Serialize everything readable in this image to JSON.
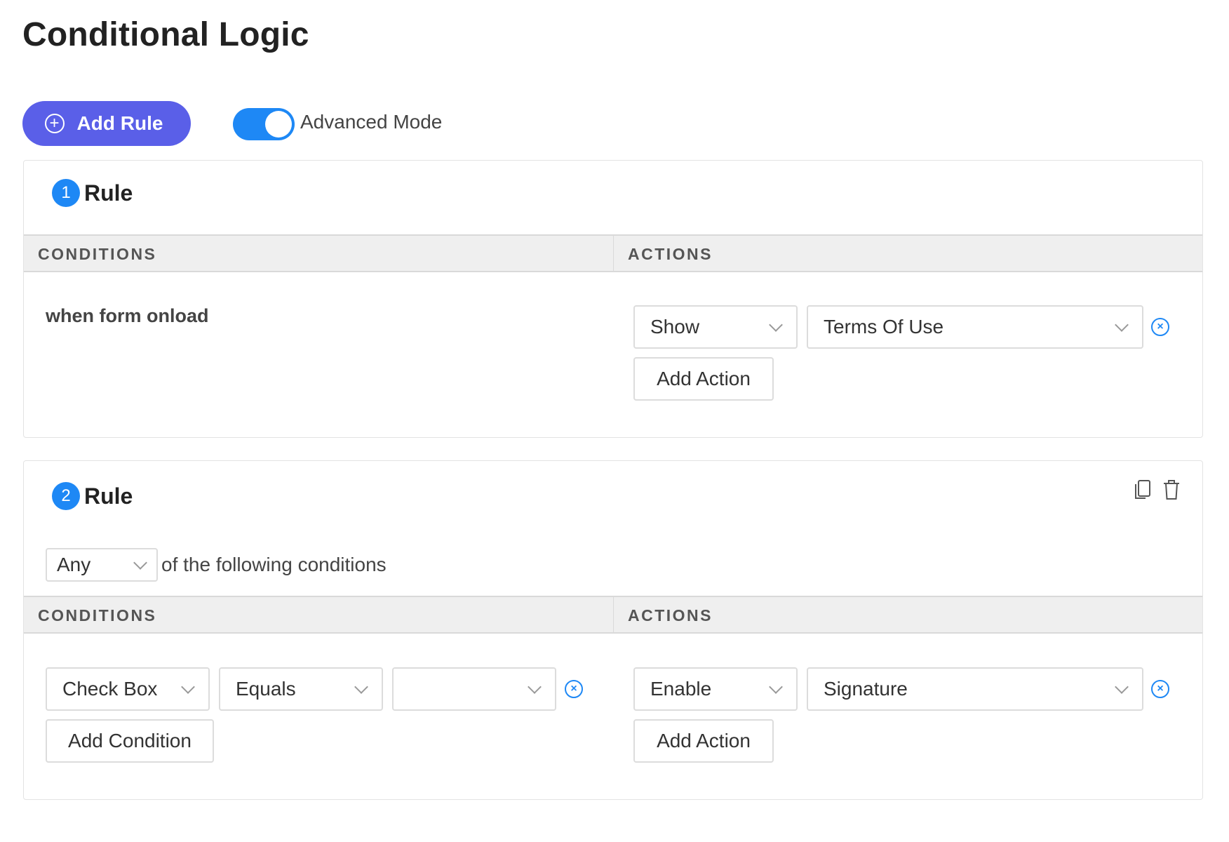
{
  "page": {
    "title": "Conditional Logic"
  },
  "toolbar": {
    "add_rule_label": "Add Rule",
    "advanced_mode_label": "Advanced Mode",
    "advanced_mode_enabled": true
  },
  "colors": {
    "primary_button": "#5a5fe8",
    "accent_blue": "#1e88f5",
    "header_bg": "#efefef",
    "border": "#dcdcdc"
  },
  "rules": [
    {
      "number": "1",
      "label": "Rule",
      "conditions_header": "CONDITIONS",
      "actions_header": "ACTIONS",
      "condition_text": "when form onload",
      "actions": [
        {
          "action": "Show",
          "target": "Terms Of Use"
        }
      ],
      "add_action_label": "Add Action"
    },
    {
      "number": "2",
      "label": "Rule",
      "match_mode": "Any",
      "match_suffix": "of the following conditions",
      "conditions_header": "CONDITIONS",
      "actions_header": "ACTIONS",
      "conditions": [
        {
          "field": "Check Box",
          "operator": "Equals",
          "value": ""
        }
      ],
      "add_condition_label": "Add Condition",
      "actions": [
        {
          "action": "Enable",
          "target": "Signature"
        }
      ],
      "add_action_label": "Add Action"
    }
  ]
}
